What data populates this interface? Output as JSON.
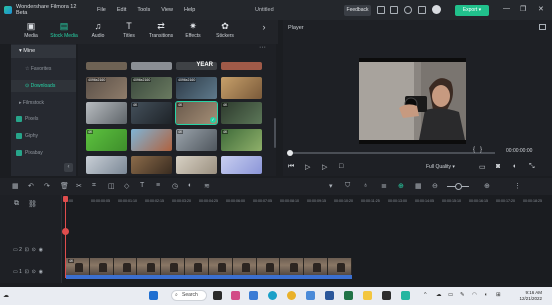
{
  "app": {
    "title": "Wondershare Filmora 12 Beta",
    "menus": [
      "File",
      "Edit",
      "Tools",
      "View",
      "Help"
    ],
    "document_title": "Untitled",
    "feedback_label": "Feedback",
    "export_label": "Export",
    "accent_color": "#27d3a6",
    "export_color": "#21c18c"
  },
  "top_tabs": [
    {
      "label": "Media",
      "icon": "media-icon"
    },
    {
      "label": "Stock Media",
      "icon": "stock-media-icon",
      "active": true
    },
    {
      "label": "Audio",
      "icon": "music-note-icon"
    },
    {
      "label": "Titles",
      "icon": "text-t-icon"
    },
    {
      "label": "Transitions",
      "icon": "transitions-icon"
    },
    {
      "label": "Effects",
      "icon": "effects-icon"
    },
    {
      "label": "Stickers",
      "icon": "stickers-icon"
    }
  ],
  "sidebar": {
    "section": "Mine",
    "items": [
      {
        "label": "Favorites"
      },
      {
        "label": "Downloads",
        "active": true
      },
      {
        "label": "Filmstock"
      },
      {
        "label": "Pixels"
      },
      {
        "label": "Giphy"
      },
      {
        "label": "Pixabay"
      }
    ]
  },
  "media_grid": {
    "thumbs": [
      {
        "label": "4096x2160"
      },
      {
        "label": "4096x2160"
      },
      {
        "label": "4096x2160"
      },
      {
        "label": ""
      },
      {
        "label": ""
      },
      {
        "label": "4K"
      },
      {
        "label": "4K"
      },
      {
        "label": "4K"
      },
      {
        "label": "4K"
      },
      {
        "label": ""
      },
      {
        "label": "4K"
      },
      {
        "label": "4K"
      },
      {
        "label": ""
      },
      {
        "label": ""
      },
      {
        "label": ""
      },
      {
        "label": ""
      }
    ],
    "banner_text": "YEAR"
  },
  "player": {
    "title": "Player",
    "timecode": "00:00:00:00",
    "quality": "Full Quality",
    "brace_open": "{",
    "brace_close": "}"
  },
  "timeline": {
    "ruler_ticks": [
      "00:00",
      "00:00:00:05",
      "00:00:01:10",
      "00:00:02:15",
      "00:00:03:20",
      "00:00:04:25",
      "00:00:06:00",
      "00:00:07:05",
      "00:00:08:10",
      "00:00:09:15",
      "00:00:10:20",
      "00:00:11:25",
      "00:00:13:00",
      "00:00:14:05",
      "00:00:15:10",
      "00:00:16:15",
      "00:00:17:20",
      "00:00:18:25"
    ],
    "track2_label": "2",
    "track1_label": "1",
    "clip_label": "4K"
  },
  "taskbar": {
    "search_label": "Search",
    "time": "9:16 AM",
    "date": "12/21/2022"
  }
}
